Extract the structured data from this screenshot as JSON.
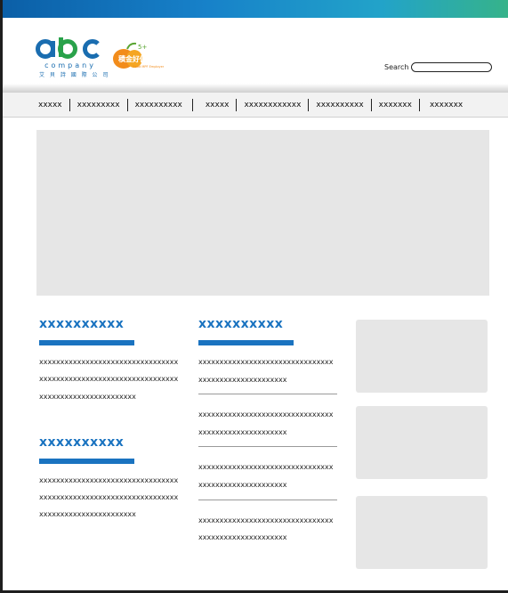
{
  "header": {
    "logo": {
      "wordmark": "abc",
      "company": "company",
      "chinese": "艾 貝 詩 國 際 公 司"
    },
    "badge": {
      "main": "積金好僱主",
      "sub": "Good MPF Employer",
      "years": "5+"
    },
    "search": {
      "label": "Search",
      "value": "",
      "placeholder": ""
    }
  },
  "nav": {
    "items": [
      "xxxxx",
      "xxxxxxxxx",
      "xxxxxxxxxx",
      "xxxxx",
      "xxxxxxxxxxxx",
      "xxxxxxxxxx",
      "xxxxxxx",
      "xxxxxxx"
    ]
  },
  "left_column": {
    "sections": [
      {
        "title": "xxxxxxxxxx",
        "text": "xxxxxxxxxxxxxxxxxxxxxxxxxxxxxxxxxxxxxxxxxxxxxxxxxxxxxxxxxxxxxxxxxxxxxxxxxxxxxxxxxxxxxxxxx"
      },
      {
        "title": "xxxxxxxxxx",
        "text": "xxxxxxxxxxxxxxxxxxxxxxxxxxxxxxxxxxxxxxxxxxxxxxxxxxxxxxxxxxxxxxxxxxxxxxxxxxxxxxxxxxxxxxxxx"
      }
    ]
  },
  "middle_column": {
    "title": "xxxxxxxxxx",
    "items": [
      "xxxxxxxxxxxxxxxxxxxxxxxxxxxxxxxxxxxxxxxxxxxxxxxxxxxxx",
      "xxxxxxxxxxxxxxxxxxxxxxxxxxxxxxxxxxxxxxxxxxxxxxxxxxxxx",
      "xxxxxxxxxxxxxxxxxxxxxxxxxxxxxxxxxxxxxxxxxxxxxxxxxxxxx",
      "xxxxxxxxxxxxxxxxxxxxxxxxxxxxxxxxxxxxxxxxxxxxxxxxxxxxx"
    ]
  },
  "colors": {
    "accent": "#1a73c0",
    "placeholder_gray": "#e6e6e6",
    "nav_bg": "#f2f2f2"
  }
}
